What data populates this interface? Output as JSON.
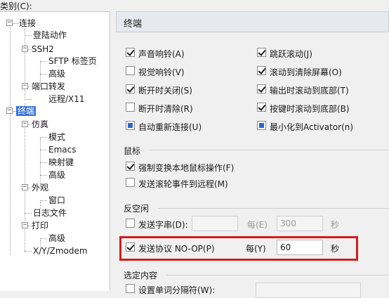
{
  "category_label": "类别(C):",
  "tree": {
    "items": [
      {
        "label": "连接"
      },
      {
        "label": "登陆动作"
      },
      {
        "label": "SSH2"
      },
      {
        "label": "SFTP 标签页"
      },
      {
        "label": "高级"
      },
      {
        "label": "端口转发"
      },
      {
        "label": "远程/X11"
      },
      {
        "label": "终端"
      },
      {
        "label": "仿真"
      },
      {
        "label": "模式"
      },
      {
        "label": "Emacs"
      },
      {
        "label": "映射键"
      },
      {
        "label": "高级"
      },
      {
        "label": "外观"
      },
      {
        "label": "窗口"
      },
      {
        "label": "日志文件"
      },
      {
        "label": "打印"
      },
      {
        "label": "高级"
      },
      {
        "label": "X/Y/Zmodem"
      }
    ],
    "selected": "终端"
  },
  "panel": {
    "title": "终端",
    "terminal_options": [
      {
        "label": "声音响铃(A)",
        "checked": true
      },
      {
        "label": "跳跃滚动(J)",
        "checked": true
      },
      {
        "label": "视觉响铃(V)",
        "checked": false
      },
      {
        "label": "滚动到清除屏幕(O)",
        "checked": true
      },
      {
        "label": "断开时关闭(S)",
        "checked": true
      },
      {
        "label": "输出时滚动到底部(T)",
        "checked": true
      },
      {
        "label": "断开时清除(R)",
        "checked": false
      },
      {
        "label": "按键时滚动到底部(B)",
        "checked": true
      },
      {
        "label": "自动重新连接(U)",
        "checked": "indeterminate"
      },
      {
        "label": "最小化到Activator(n)",
        "checked": "indeterminate"
      }
    ],
    "mouse": {
      "title": "鼠标",
      "options": [
        {
          "label": "强制变换本地鼠标操作(F)",
          "checked": true
        },
        {
          "label": "发送滚轮事件到远程(M)",
          "checked": false
        }
      ]
    },
    "anti_idle": {
      "title": "反空闲",
      "send_string": {
        "label": "发送字串(D):",
        "checked": false,
        "value": "",
        "every_label": "每(E)",
        "seconds": "300",
        "unit": "秒"
      },
      "send_noop": {
        "label": "发送协议 NO-OP(P)",
        "checked": true,
        "every_label": "每(Y)",
        "seconds": "60",
        "unit": "秒"
      }
    },
    "selection": {
      "title": "选定内容",
      "word_delimiter_label": "设置单词分隔符(W):"
    }
  },
  "colors": {
    "highlight_box": "#d41c1c",
    "tree_selection": "#3874d8",
    "indeterminate_fill": "#2a66c9"
  }
}
